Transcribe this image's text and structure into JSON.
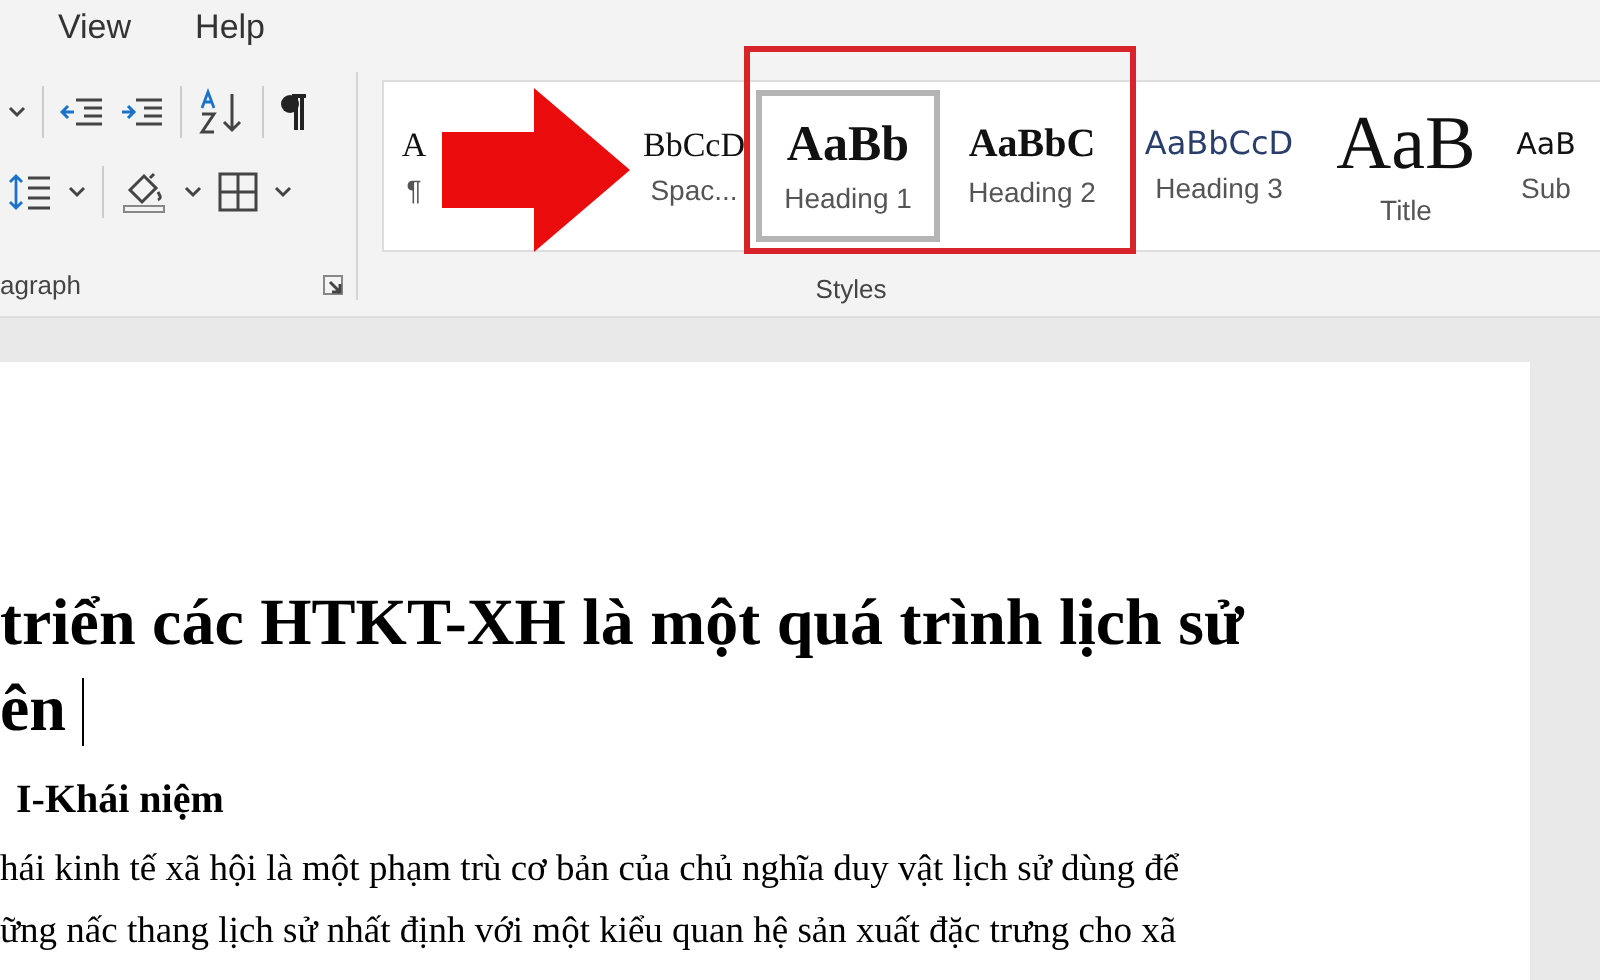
{
  "menu": [
    {
      "label": "View"
    },
    {
      "label": "Help"
    }
  ],
  "paragraph_group": {
    "label": "agraph"
  },
  "styles_group": {
    "label": "Styles",
    "items": [
      {
        "preview": "A",
        "label": "¶",
        "selected": false,
        "kind": "normal"
      },
      {
        "preview": "BbCcD",
        "label": "Spac...",
        "selected": false,
        "kind": "normal"
      },
      {
        "preview": "AaBb",
        "label": "Heading 1",
        "selected": true,
        "kind": "heading1"
      },
      {
        "preview": "AaBbC",
        "label": "Heading 2",
        "selected": false,
        "kind": "heading2"
      },
      {
        "preview": "AaBbCcD",
        "label": "Heading 3",
        "selected": false,
        "kind": "heading3"
      },
      {
        "preview": "AaB",
        "label": "Title",
        "selected": false,
        "kind": "title"
      },
      {
        "preview": "AaB",
        "label": "Sub",
        "selected": false,
        "kind": "subtitle"
      }
    ]
  },
  "document": {
    "heading_lines": [
      "triển các HTKT-XH là một quá trình lịch sử",
      "ên"
    ],
    "subheading": "I-Khái niệm",
    "body_lines": [
      "hái kinh tế xã hội là một phạm trù cơ bản của chủ nghĩa duy vật lịch sử dùng để",
      "ững nấc thang lịch sử nhất định với một kiểu quan hệ sản xuất đặc trưng cho xã"
    ]
  }
}
